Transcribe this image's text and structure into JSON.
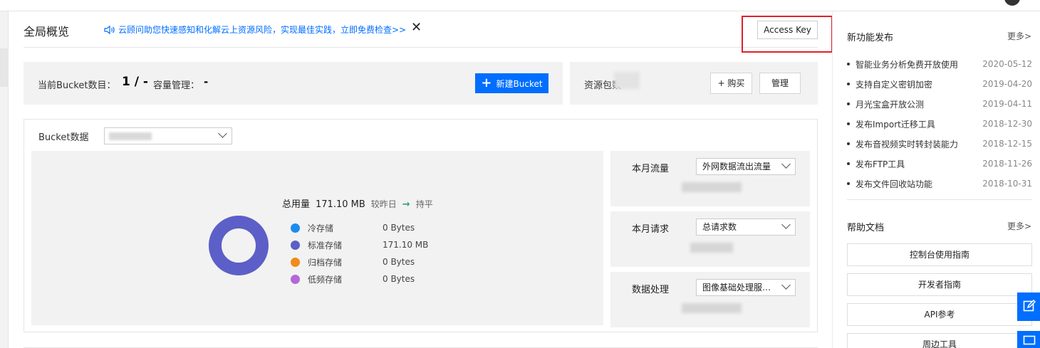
{
  "header": {
    "title": "全局概览",
    "notice": "云顾问助您快速感知和化解云上资源风险，实现最佳实践，立即免费检查>>",
    "close": "✕",
    "access_key_label": "Access Key"
  },
  "bucket_bar": {
    "count_label": "当前Bucket数目：",
    "count_value": "1 / -",
    "capacity_label": "容量管理：",
    "capacity_value": "-",
    "new_bucket_label": "新建Bucket"
  },
  "resource_bar": {
    "label": "资源包数",
    "buy_label": "+ 购买",
    "manage_label": "管理"
  },
  "stats": {
    "bucket_label": "Bucket数据",
    "total_label": "总用量",
    "total_value": "171.10 MB",
    "compare_label": "较昨日",
    "trend_arrow": "→",
    "trend_text": "持平",
    "legend": [
      {
        "name": "冷存储",
        "value": "0 Bytes",
        "color": "#1a8cf0"
      },
      {
        "name": "标准存储",
        "value": "171.10 MB",
        "color": "#5b5fc7"
      },
      {
        "name": "归档存储",
        "value": "0 Bytes",
        "color": "#f08c1a"
      },
      {
        "name": "低频存储",
        "value": "0 Bytes",
        "color": "#b368d9"
      }
    ],
    "cards": [
      {
        "label": "本月流量",
        "select": "外网数据流出流量"
      },
      {
        "label": "本月请求",
        "select": "总请求数"
      },
      {
        "label": "数据处理",
        "select": "图像基础处理服…"
      }
    ]
  },
  "sidebar": {
    "news_title": "新功能发布",
    "news_more": "更多>",
    "news": [
      {
        "title": "智能业务分析免费开放使用",
        "date": "2020-05-12"
      },
      {
        "title": "支持自定义密钥加密",
        "date": "2019-04-20"
      },
      {
        "title": "月光宝盒开放公测",
        "date": "2019-04-11"
      },
      {
        "title": "发布Import迁移工具",
        "date": "2018-12-30"
      },
      {
        "title": "发布音视频实时转封装能力",
        "date": "2018-12-15"
      },
      {
        "title": "发布FTP工具",
        "date": "2018-11-26"
      },
      {
        "title": "发布文件回收站功能",
        "date": "2018-10-31"
      }
    ],
    "docs_title": "帮助文档",
    "docs_more": "更多>",
    "docs": [
      "控制台使用指南",
      "开发者指南",
      "API参考",
      "周边工具"
    ]
  },
  "colors": {
    "accent": "#006eff",
    "highlight": "#e0202a",
    "trend": "#2ba471"
  }
}
